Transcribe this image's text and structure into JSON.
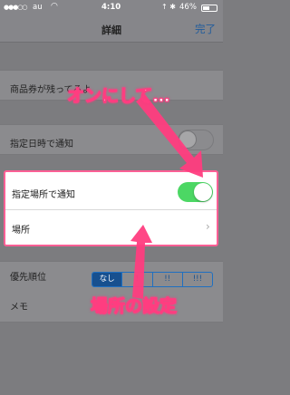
{
  "status_bar": {
    "signal": "●●●○○",
    "carrier": "au",
    "wifi_icon": "wifi-icon",
    "time": "4:10",
    "right_icons": "↑ ✱",
    "battery": "46%"
  },
  "nav": {
    "title": "詳細",
    "done": "完了"
  },
  "rows": {
    "coupon": "商品券が残ってるよ",
    "date_notify": "指定日時で通知",
    "place_notify": "指定場所で通知",
    "place": "場所",
    "priority": "優先順位",
    "memo": "メモ"
  },
  "priority_options": [
    "なし",
    "!",
    "!!",
    "!!!"
  ],
  "toggles": {
    "date_notify": false,
    "place_notify": true
  },
  "annotations": {
    "top_caption": "オンにして…",
    "bottom_caption": "場所の設定",
    "color": "#ff3d80"
  },
  "colors": {
    "accent": "#1f5b9c",
    "toggle_on": "#4cd764",
    "highlight_border": "#ff5f95"
  }
}
